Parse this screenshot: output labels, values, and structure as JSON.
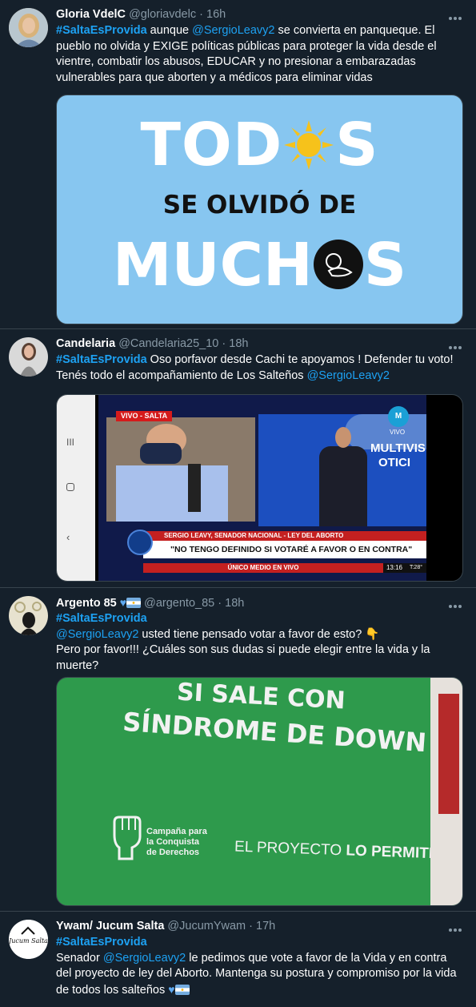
{
  "tweets": [
    {
      "name": "Gloria VdelC",
      "handle": "@gloriavdelc",
      "dot": "·",
      "time": "16h",
      "hashtag": "#SaltaEsProvida",
      "t1": " aunque ",
      "mention": "@SergioLeavy2",
      "t2": " se convierta en panqueque. El pueblo no olvida y EXIGE políticas públicas para proteger la vida desde el vientre, combatir los abusos, EDUCAR y no presionar a embarazadas vulnerables para que aborten y a médicos para eliminar vidas",
      "image": {
        "line1_a": "TOD",
        "line1_b": "S",
        "line2": "SE OLVIDÓ DE",
        "line3_a": "MUCH",
        "line3_b": "S",
        "bg": "#87c6f0"
      }
    },
    {
      "name": "Candelaria",
      "handle": "@Candelaria25_10",
      "dot": "·",
      "time": "18h",
      "hashtag": "#SaltaEsProvida",
      "t1": " Oso porfavor desde Cachi te apoyamos ! Defender tu voto! Tenés todo el acompañamiento de Los Salteños ",
      "mention": "@SergioLeavy2",
      "image": {
        "badge": "VIVO - SALTA",
        "lower_title": "SERGIO LEAVY, SENADOR NACIONAL - LEY DEL ABORTO",
        "quote": "\"NO TENGO DEFINIDO SI VOTARÉ A FAVOR O EN CONTRA\"",
        "ticker": "ÚNICO MEDIO EN VIVO",
        "clock": "13:16",
        "temp": "T:28°",
        "logo_label": "VIVO",
        "screen_text_1": "MULTIVIS",
        "screen_text_2": "OTICI"
      }
    },
    {
      "name": "Argento 85",
      "handle": "@argento_85",
      "dot": "·",
      "time": "18h",
      "hashtag": "#SaltaEsProvida",
      "mention": "@SergioLeavy2",
      "t1": " usted tiene pensado votar a favor de esto? 👇",
      "t2": "Pero por favor!!! ¿Cuáles son sus dudas si puede elegir entre la vida y la muerte?",
      "image": {
        "line1": "SI SALE CON",
        "line2": "SÍNDROME DE DOWN",
        "campaign1": "Campaña para",
        "campaign2": "la Conquista",
        "campaign3": "de Derechos",
        "footer_a": "EL PROYECTO ",
        "footer_b": "LO PERMITE",
        "bg": "#2e9a4c"
      }
    },
    {
      "name": "Ywam/ Jucum Salta",
      "handle": "@JucumYwam",
      "dot": "·",
      "time": "17h",
      "hashtag": "#SaltaEsProvida",
      "t1": "Senador ",
      "mention": "@SergioLeavy2",
      "t2": "  le pedimos que vote a favor de la Vida y en contra del proyecto de ley del Aborto. Mantenga su postura y compromiso por la vida de todos los salteños ",
      "avatar_text": "Jucum Salta"
    }
  ],
  "colors": {
    "background": "#15202b",
    "link": "#1da1f2",
    "muted": "#8899a6",
    "divider": "#38444d"
  }
}
